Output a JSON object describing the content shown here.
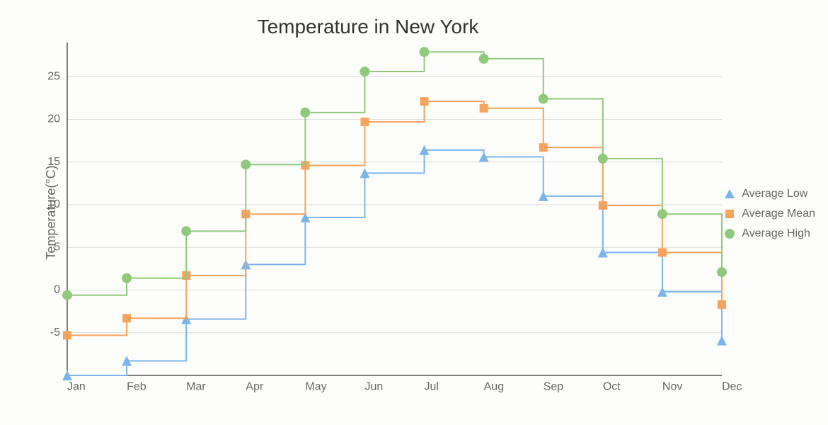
{
  "chart_data": {
    "type": "line",
    "step": "pre",
    "title": "Temperature in New York",
    "xlabel": "",
    "ylabel": "Temperature(°C)",
    "categories": [
      "Jan",
      "Feb",
      "Mar",
      "Apr",
      "May",
      "Jun",
      "Jul",
      "Aug",
      "Sep",
      "Oct",
      "Nov",
      "Dec"
    ],
    "ylim": [
      -10,
      29
    ],
    "yticks": [
      -5,
      0,
      5,
      10,
      15,
      20,
      25
    ],
    "grid": {
      "y": true,
      "x": false
    },
    "legend_position": "right",
    "series": [
      {
        "name": "Average Low",
        "color": "#7cb5ec",
        "marker": "triangle",
        "values": [
          -10.0,
          -8.3,
          -3.4,
          3.0,
          8.5,
          13.7,
          16.4,
          15.6,
          11.0,
          4.4,
          -0.2,
          -5.9
        ]
      },
      {
        "name": "Average Mean",
        "color": "#f7a35c",
        "marker": "square",
        "values": [
          -5.3,
          -3.3,
          1.7,
          8.9,
          14.6,
          19.7,
          22.1,
          21.3,
          16.7,
          9.9,
          4.4,
          -1.7
        ]
      },
      {
        "name": "Average High",
        "color": "#90c97c",
        "marker": "circle",
        "values": [
          -0.6,
          1.4,
          6.9,
          14.7,
          20.8,
          25.6,
          27.9,
          27.1,
          22.4,
          15.4,
          8.9,
          2.1
        ]
      }
    ]
  }
}
